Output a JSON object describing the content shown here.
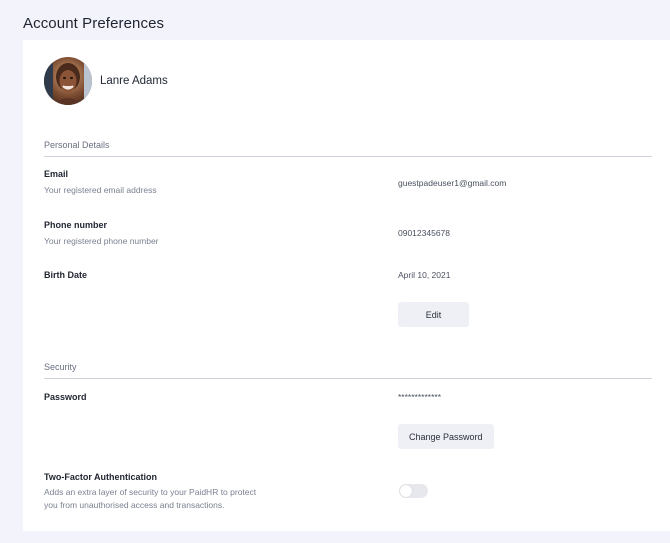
{
  "header": {
    "title": "Account Preferences"
  },
  "profile": {
    "name": "Lanre Adams"
  },
  "personal": {
    "section_label": "Personal Details",
    "email": {
      "title": "Email",
      "subtitle": "Your registered email address",
      "value": "guestpadeuser1@gmail.com"
    },
    "phone": {
      "title": "Phone number",
      "subtitle": "Your registered phone number",
      "value": "09012345678"
    },
    "birth": {
      "title": "Birth Date",
      "value": "April 10, 2021"
    },
    "edit_label": "Edit"
  },
  "security": {
    "section_label": "Security",
    "password": {
      "title": "Password",
      "value": "*************"
    },
    "change_password_label": "Change Password",
    "two_factor": {
      "title": "Two-Factor Authentication",
      "subtitle_line1": "Adds an extra layer of security to your PaidHR to protect",
      "subtitle_line2": "you from unauthorised access and transactions.",
      "enabled": false
    }
  },
  "colors": {
    "toggle_off": "#e6e8ee",
    "divider": "#cfd3db",
    "button_bg": "#eef0f5"
  }
}
